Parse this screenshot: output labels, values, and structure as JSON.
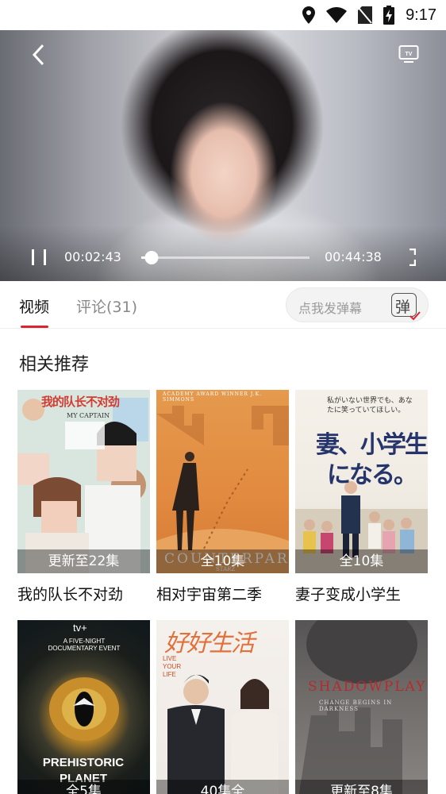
{
  "status_bar": {
    "time": "9:17"
  },
  "player": {
    "current_time": "00:02:43",
    "total_time": "00:44:38",
    "progress": 0.06
  },
  "tabs": {
    "video": "视频",
    "comments": "评论(31)",
    "danmaku_placeholder": "点我发弹幕",
    "danmaku_button": "弹"
  },
  "section": {
    "title": "相关推荐"
  },
  "posters": {
    "p1_top": "我的队长不对劲",
    "p1_sub": "MY CAPTAIN",
    "p2_top": "ACADEMY AWARD WINNER J.K. SIMMONS",
    "p2_mid": "COUNTERPART",
    "p2_starz": "STARZ",
    "p3_top": "私がいない世界でも、あなたに笑っていてほしい。",
    "p3_title1": "妻、小学生",
    "p3_title2": "になる。",
    "p4_brand": "tv+",
    "p4_top": "A FIVE-NIGHT DOCUMENTARY EVENT",
    "p4_title": "PREHISTORIC PLANET",
    "p5_title": "好好生活",
    "p5_sub": "LIVE YOUR LIFE",
    "p6_title": "SHADOWPLAY",
    "p6_sub": "CHANGE BEGINS IN DARKNESS"
  },
  "recommendations": [
    {
      "title": "我的队长不对劲",
      "badge": "更新至22集"
    },
    {
      "title": "相对宇宙第二季",
      "badge": "全10集"
    },
    {
      "title": "妻子变成小学生",
      "badge": "全10集"
    },
    {
      "title": "",
      "badge": "全5集"
    },
    {
      "title": "",
      "badge": "40集全"
    },
    {
      "title": "",
      "badge": "更新至8集"
    }
  ]
}
